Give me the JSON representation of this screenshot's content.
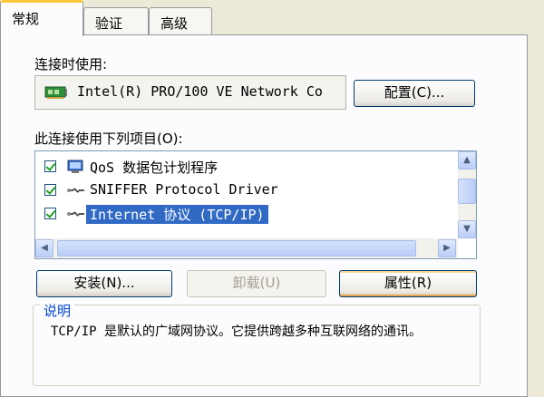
{
  "tabs": [
    {
      "label": "常规",
      "active": true
    },
    {
      "label": "验证",
      "active": false
    },
    {
      "label": "高级",
      "active": false
    }
  ],
  "connect_using_label": "连接时使用:",
  "adapter": {
    "icon": "network-card-icon",
    "name": "Intel(R) PRO/100 VE Network Co"
  },
  "configure_button": "配置(C)...",
  "items_label": "此连接使用下列项目(O):",
  "items": [
    {
      "label": "QoS 数据包计划程序",
      "checked": true,
      "icon": "qos-scheduler-icon",
      "selected": false
    },
    {
      "label": "SNIFFER Protocol Driver",
      "checked": true,
      "icon": "protocol-icon",
      "selected": false
    },
    {
      "label": "Internet 协议 (TCP/IP)",
      "checked": true,
      "icon": "protocol-icon",
      "selected": true
    }
  ],
  "buttons": {
    "install": "安装(N)...",
    "uninstall": "卸载(U)",
    "properties": "属性(R)"
  },
  "description": {
    "title": "说明",
    "text": "TCP/IP 是默认的广域网协议。它提供跨越多种互联网络的通讯。"
  },
  "colors": {
    "selection": "#316ac5",
    "tab_highlight": "#ffc83c",
    "group_title": "#0046d5"
  }
}
